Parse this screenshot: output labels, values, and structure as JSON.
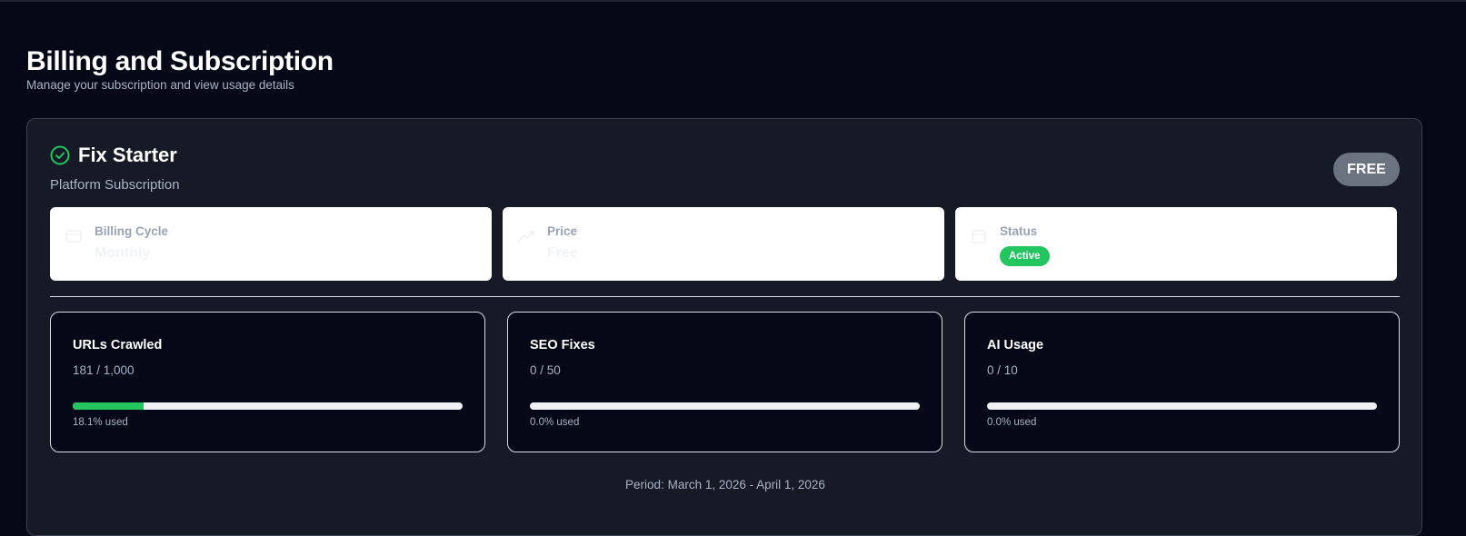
{
  "header": {
    "title": "Billing and Subscription",
    "subtitle": "Manage your subscription and view usage details"
  },
  "plan": {
    "icon": "check-circle-icon",
    "name": "Fix Starter",
    "type": "Platform Subscription",
    "badge": "FREE",
    "badge_color": "#6b7280",
    "info": [
      {
        "icon": "credit-card-icon",
        "label": "Billing Cycle",
        "value": "Monthly"
      },
      {
        "icon": "trending-up-icon",
        "label": "Price",
        "value": "Free"
      },
      {
        "icon": "calendar-icon",
        "label": "Status",
        "value": "Active"
      }
    ],
    "status_color": "#22c55e"
  },
  "usage": [
    {
      "title": "URLs Crawled",
      "count": "181 / 1,000",
      "pct_label": "18.1% used",
      "fraction": 0.181
    },
    {
      "title": "SEO Fixes",
      "count": "0 / 50",
      "pct_label": "0.0% used",
      "fraction": 0.0
    },
    {
      "title": "AI Usage",
      "count": "0 / 10",
      "pct_label": "0.0% used",
      "fraction": 0.0
    }
  ],
  "period": "Period: March 1, 2026 - April 1, 2026",
  "colors": {
    "accent_green": "#22c55e",
    "background": "#040817",
    "card_background": "#161a26"
  }
}
